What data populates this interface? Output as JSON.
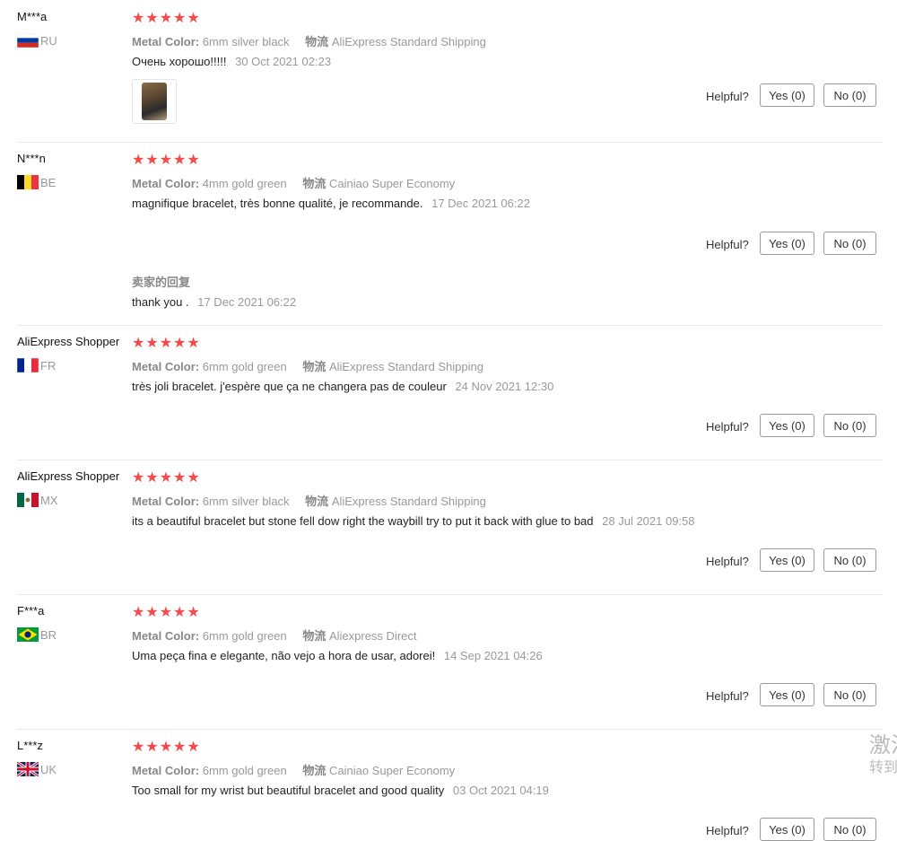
{
  "helpful_label": "Helpful?",
  "yes_label": "Yes (0)",
  "no_label": "No (0)",
  "star_glyphs": "★★★★★",
  "meta_keys": {
    "color": "Metal Color:",
    "shipping": "物流"
  },
  "reviews": [
    {
      "user": "M***a",
      "country": "RU",
      "flag": "ru",
      "rating": 5,
      "color": "6mm silver black",
      "shipping": "AliExpress Standard Shipping",
      "text": "Очень хорошо!!!!!",
      "date": "30 Oct 2021 02:23",
      "has_image": true
    },
    {
      "user": "N***n",
      "country": "BE",
      "flag": "be",
      "rating": 5,
      "color": "4mm gold green",
      "shipping": "Cainiao Super Economy",
      "text": "magnifique bracelet, très bonne qualité, je recommande.",
      "date": "17 Dec 2021 06:22",
      "seller_reply": {
        "title": "卖家的回复",
        "text": "thank you .",
        "date": "17 Dec 2021 06:22"
      }
    },
    {
      "user": "AliExpress Shopper",
      "country": "FR",
      "flag": "fr",
      "rating": 5,
      "color": "6mm gold green",
      "shipping": "AliExpress Standard Shipping",
      "text": "très joli bracelet. j'espère que ça ne changera pas de couleur",
      "date": "24 Nov 2021 12:30"
    },
    {
      "user": "AliExpress Shopper",
      "country": "MX",
      "flag": "mx",
      "rating": 5,
      "color": "6mm silver black",
      "shipping": "AliExpress Standard Shipping",
      "text": "its a beautiful bracelet but stone fell dow right the waybill try to put it back with glue to bad",
      "date": "28 Jul 2021 09:58"
    },
    {
      "user": "F***a",
      "country": "BR",
      "flag": "br",
      "rating": 5,
      "color": "6mm gold green",
      "shipping": "Aliexpress Direct",
      "text": "Uma peça fina e elegante, não vejo a hora de usar, adorei!",
      "date": "14 Sep 2021 04:26"
    },
    {
      "user": "L***z",
      "country": "UK",
      "flag": "uk",
      "rating": 5,
      "color": "6mm gold green",
      "shipping": "Cainiao Super Economy",
      "text": "Too small for my wrist but beautiful bracelet and good quality",
      "date": "03 Oct 2021 04:19"
    }
  ],
  "overlay_text": {
    "line1": "激活",
    "line2": "转到"
  }
}
